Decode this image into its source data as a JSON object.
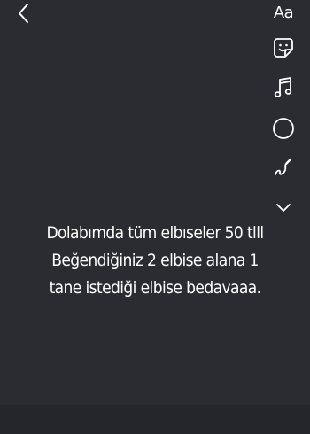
{
  "toolbar": {
    "back": {
      "icon": "chevron-left-icon"
    },
    "tools": [
      {
        "name": "text-tool",
        "label": "Aa"
      },
      {
        "name": "sticker-tool",
        "icon": "sticker-icon"
      },
      {
        "name": "music-tool",
        "icon": "music-note-icon"
      },
      {
        "name": "shape-tool",
        "icon": "circle-icon"
      },
      {
        "name": "draw-tool",
        "icon": "squiggle-pen-icon"
      },
      {
        "name": "more-tools",
        "icon": "chevron-down-icon"
      }
    ]
  },
  "story": {
    "lines": [
      "Dolabımda tüm elbıseler 50 tlll",
      "Beğendiğiniz 2 elbise alana 1",
      "tane istediği elbise bedavaaa."
    ]
  },
  "colors": {
    "background": "#2b2c32",
    "bottom_bar": "#25262b",
    "foreground": "#ffffff"
  }
}
